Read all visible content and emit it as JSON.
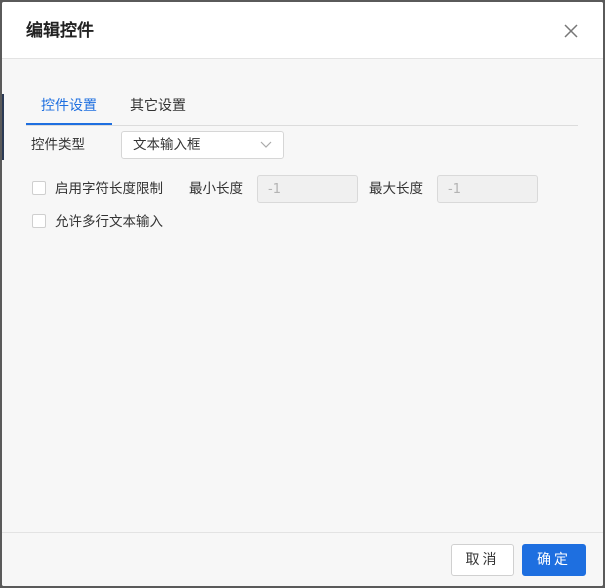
{
  "dialog": {
    "title": "编辑控件"
  },
  "tabs": [
    {
      "label": "控件设置",
      "active": true
    },
    {
      "label": "其它设置",
      "active": false
    }
  ],
  "form": {
    "control_type_label": "控件类型",
    "control_type_value": "文本输入框",
    "enable_length_limit_label": "启用字符长度限制",
    "min_length_label": "最小长度",
    "min_length_placeholder": "-1",
    "max_length_label": "最大长度",
    "max_length_placeholder": "-1",
    "multiline_label": "允许多行文本输入"
  },
  "footer": {
    "cancel_label": "取消",
    "ok_label": "确定"
  },
  "colors": {
    "accent": "#1e6fe0",
    "background": "#f7f7f7"
  },
  "icons": {
    "close": "close-icon",
    "dropdown": "chevron-down-icon"
  }
}
